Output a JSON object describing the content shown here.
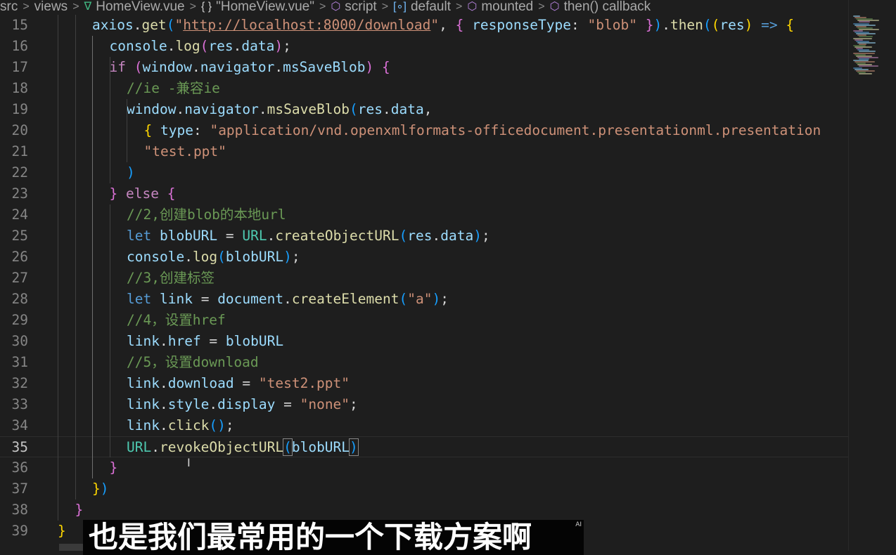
{
  "breadcrumb": {
    "segments": [
      "src",
      "views",
      "HomeView.vue",
      "\"HomeView.vue\"",
      "script",
      "default",
      "mounted",
      "then() callback"
    ],
    "icons": [
      "",
      "",
      "vue-file-icon",
      "braces-icon",
      "cube-icon",
      "bracket-icon",
      "cube-icon",
      "cube-icon"
    ]
  },
  "editor": {
    "current_line": 35,
    "lines": [
      {
        "n": "15",
        "tokens": [
          [
            "axios",
            "t-var"
          ],
          [
            ".",
            "t-pl"
          ],
          [
            "get",
            "t-fn"
          ],
          [
            "(",
            "t-b3"
          ],
          [
            "\"",
            "t-str"
          ],
          [
            "http://localhost:8000/download",
            "t-str t-url"
          ],
          [
            "\"",
            "t-str"
          ],
          [
            ", ",
            "t-pl"
          ],
          [
            "{",
            "t-b2"
          ],
          [
            " ",
            "t-pl"
          ],
          [
            "responseType",
            "t-var"
          ],
          [
            ": ",
            "t-pl"
          ],
          [
            "\"blob\"",
            "t-str"
          ],
          [
            " ",
            "t-pl"
          ],
          [
            "}",
            "t-b2"
          ],
          [
            ")",
            "t-b3"
          ],
          [
            ".",
            "t-pl"
          ],
          [
            "then",
            "t-fn"
          ],
          [
            "(",
            "t-b3"
          ],
          [
            "(",
            "t-b1"
          ],
          [
            "res",
            "t-var"
          ],
          [
            ")",
            "t-b1"
          ],
          [
            " ",
            "t-pl"
          ],
          [
            "=>",
            "t-kw"
          ],
          [
            " ",
            "t-pl"
          ],
          [
            "{",
            "t-b1"
          ]
        ]
      },
      {
        "n": "16",
        "tokens": [
          [
            "console",
            "t-var"
          ],
          [
            ".",
            "t-pl"
          ],
          [
            "log",
            "t-fn"
          ],
          [
            "(",
            "t-b2"
          ],
          [
            "res",
            "t-var"
          ],
          [
            ".",
            "t-pl"
          ],
          [
            "data",
            "t-var"
          ],
          [
            ")",
            "t-b2"
          ],
          [
            ";",
            "t-pl"
          ]
        ]
      },
      {
        "n": "17",
        "tokens": [
          [
            "if",
            "t-ctrl"
          ],
          [
            " ",
            "t-pl"
          ],
          [
            "(",
            "t-b2"
          ],
          [
            "window",
            "t-var"
          ],
          [
            ".",
            "t-pl"
          ],
          [
            "navigator",
            "t-var"
          ],
          [
            ".",
            "t-pl"
          ],
          [
            "msSaveBlob",
            "t-var"
          ],
          [
            ")",
            "t-b2"
          ],
          [
            " ",
            "t-pl"
          ],
          [
            "{",
            "t-b2"
          ]
        ]
      },
      {
        "n": "18",
        "tokens": [
          [
            "//ie -兼容ie",
            "t-cmt"
          ]
        ]
      },
      {
        "n": "19",
        "tokens": [
          [
            "window",
            "t-var"
          ],
          [
            ".",
            "t-pl"
          ],
          [
            "navigator",
            "t-var"
          ],
          [
            ".",
            "t-pl"
          ],
          [
            "msSaveBlob",
            "t-fn"
          ],
          [
            "(",
            "t-b3"
          ],
          [
            "res",
            "t-var"
          ],
          [
            ".",
            "t-pl"
          ],
          [
            "data",
            "t-var"
          ],
          [
            ",",
            "t-pl"
          ]
        ]
      },
      {
        "n": "20",
        "tokens": [
          [
            "{",
            "t-b1"
          ],
          [
            " ",
            "t-pl"
          ],
          [
            "type",
            "t-var"
          ],
          [
            ": ",
            "t-pl"
          ],
          [
            "\"application/vnd.openxmlformats-officedocument.presentationml.presentation",
            "t-str"
          ]
        ]
      },
      {
        "n": "21",
        "tokens": [
          [
            "\"test.ppt\"",
            "t-str"
          ]
        ]
      },
      {
        "n": "22",
        "tokens": [
          [
            ")",
            "t-b3"
          ]
        ]
      },
      {
        "n": "23",
        "tokens": [
          [
            "}",
            "t-b2"
          ],
          [
            " ",
            "t-pl"
          ],
          [
            "else",
            "t-ctrl"
          ],
          [
            " ",
            "t-pl"
          ],
          [
            "{",
            "t-b2"
          ]
        ]
      },
      {
        "n": "24",
        "tokens": [
          [
            "//2,创建blob的本地url",
            "t-cmt"
          ]
        ]
      },
      {
        "n": "25",
        "tokens": [
          [
            "let",
            "t-kw"
          ],
          [
            " ",
            "t-pl"
          ],
          [
            "blobURL",
            "t-var"
          ],
          [
            " = ",
            "t-pl"
          ],
          [
            "URL",
            "t-cls"
          ],
          [
            ".",
            "t-pl"
          ],
          [
            "createObjectURL",
            "t-fn"
          ],
          [
            "(",
            "t-b3"
          ],
          [
            "res",
            "t-var"
          ],
          [
            ".",
            "t-pl"
          ],
          [
            "data",
            "t-var"
          ],
          [
            ")",
            "t-b3"
          ],
          [
            ";",
            "t-pl"
          ]
        ]
      },
      {
        "n": "26",
        "tokens": [
          [
            "console",
            "t-var"
          ],
          [
            ".",
            "t-pl"
          ],
          [
            "log",
            "t-fn"
          ],
          [
            "(",
            "t-b3"
          ],
          [
            "blobURL",
            "t-var"
          ],
          [
            ")",
            "t-b3"
          ],
          [
            ";",
            "t-pl"
          ]
        ]
      },
      {
        "n": "27",
        "tokens": [
          [
            "//3,创建标签",
            "t-cmt"
          ]
        ]
      },
      {
        "n": "28",
        "tokens": [
          [
            "let",
            "t-kw"
          ],
          [
            " ",
            "t-pl"
          ],
          [
            "link",
            "t-var"
          ],
          [
            " = ",
            "t-pl"
          ],
          [
            "document",
            "t-var"
          ],
          [
            ".",
            "t-pl"
          ],
          [
            "createElement",
            "t-fn"
          ],
          [
            "(",
            "t-b3"
          ],
          [
            "\"a\"",
            "t-str"
          ],
          [
            ")",
            "t-b3"
          ],
          [
            ";",
            "t-pl"
          ]
        ]
      },
      {
        "n": "29",
        "tokens": [
          [
            "//4，设置href",
            "t-cmt"
          ]
        ]
      },
      {
        "n": "30",
        "tokens": [
          [
            "link",
            "t-var"
          ],
          [
            ".",
            "t-pl"
          ],
          [
            "href",
            "t-var"
          ],
          [
            " = ",
            "t-pl"
          ],
          [
            "blobURL",
            "t-var"
          ]
        ]
      },
      {
        "n": "31",
        "tokens": [
          [
            "//5，设置download",
            "t-cmt"
          ]
        ]
      },
      {
        "n": "32",
        "tokens": [
          [
            "link",
            "t-var"
          ],
          [
            ".",
            "t-pl"
          ],
          [
            "download",
            "t-var"
          ],
          [
            " = ",
            "t-pl"
          ],
          [
            "\"test2.ppt\"",
            "t-str"
          ]
        ]
      },
      {
        "n": "33",
        "tokens": [
          [
            "link",
            "t-var"
          ],
          [
            ".",
            "t-pl"
          ],
          [
            "style",
            "t-var"
          ],
          [
            ".",
            "t-pl"
          ],
          [
            "display",
            "t-var"
          ],
          [
            " = ",
            "t-pl"
          ],
          [
            "\"none\"",
            "t-str"
          ],
          [
            ";",
            "t-pl"
          ]
        ]
      },
      {
        "n": "34",
        "tokens": [
          [
            "link",
            "t-var"
          ],
          [
            ".",
            "t-pl"
          ],
          [
            "click",
            "t-fn"
          ],
          [
            "(",
            "t-b3"
          ],
          [
            ")",
            "t-b3"
          ],
          [
            ";",
            "t-pl"
          ]
        ]
      },
      {
        "n": "35",
        "tokens": [
          [
            "URL",
            "t-cls"
          ],
          [
            ".",
            "t-pl"
          ],
          [
            "revokeObjectURL",
            "t-fn"
          ],
          [
            "(",
            "t-b3 t-match"
          ],
          [
            "blobURL",
            "t-var"
          ],
          [
            ")",
            "t-b3 t-match"
          ]
        ]
      },
      {
        "n": "36",
        "tokens": [
          [
            "}",
            "t-b2"
          ]
        ]
      },
      {
        "n": "37",
        "tokens": [
          [
            "}",
            "t-b1"
          ],
          [
            ")",
            "t-b3"
          ]
        ]
      },
      {
        "n": "38",
        "tokens": [
          [
            "}",
            "t-b2"
          ]
        ]
      },
      {
        "n": "39",
        "tokens": [
          [
            "}",
            "t-b1"
          ]
        ]
      }
    ]
  },
  "subtitle": {
    "text": "也是我们最常用的一个下载方案啊",
    "tag": "AI"
  },
  "colors": {
    "background": "#1e1e1e",
    "comment": "#6a9955",
    "string": "#ce9178",
    "keyword": "#569cd6"
  }
}
